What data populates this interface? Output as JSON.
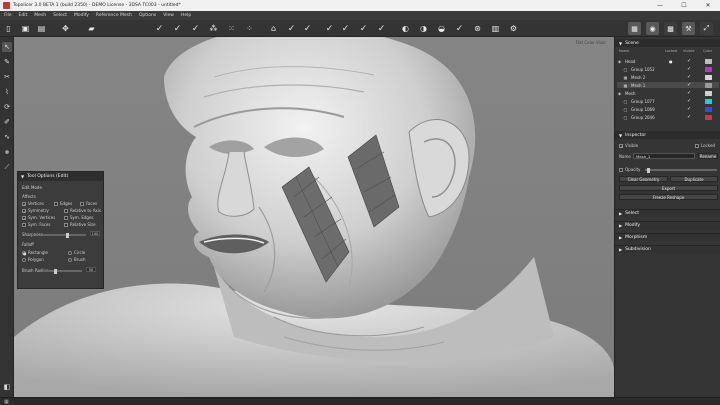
{
  "window": {
    "title": "Topolicer 3.0 BETA 1 (build 2350) - DEMO License - 3DSA TC003 - untitled*",
    "controls": [
      "—",
      "☐",
      "✕"
    ]
  },
  "menu": [
    "File",
    "Edit",
    "Mesh",
    "Select",
    "Modify",
    "Reference Mesh",
    "Options",
    "View",
    "Help"
  ],
  "viewport": {
    "label": "Flat Color Visor"
  },
  "tool_options": {
    "title": "Tool Options (Edit)",
    "mode_label": "Edit Mode",
    "group_label": "Affects",
    "rows": [
      {
        "left": "Vertices",
        "left_checked": true,
        "mid": "Edges",
        "right": "Faces"
      },
      {
        "left": "Symmetry",
        "left_checked": true,
        "mid": "Relative to Axis"
      },
      {
        "left": "Sym. Vertices",
        "left_checked": true,
        "mid": "Sym. Edges"
      },
      {
        "left": "Sym. Faces",
        "left_checked": false,
        "mid": "Relative Size"
      }
    ],
    "sharpness_label": "Sharpness",
    "sharpness_value": "100",
    "falloff_label": "Falloff",
    "falloff_rows": [
      {
        "left": "Rectangle",
        "right": "Circle"
      },
      {
        "left": "Polygon",
        "right": "Brush"
      }
    ],
    "brush_radius_label": "Brush Radius",
    "brush_radius_value": "50"
  },
  "scene": {
    "title": "Scene",
    "columns": [
      "Name",
      "Locked",
      "Visible",
      "Color"
    ],
    "rows": [
      {
        "name": "Head",
        "indent": 0,
        "icon": "mesh",
        "locked": true,
        "visible": true,
        "color": "#bdbdbd",
        "selected": false
      },
      {
        "name": "Group 1052",
        "indent": 1,
        "icon": "group",
        "locked": false,
        "visible": true,
        "color": "#b03ac0",
        "selected": false
      },
      {
        "name": "Mesh 2",
        "indent": 1,
        "icon": "grid",
        "locked": false,
        "visible": true,
        "color": "#d8d8d8",
        "selected": false
      },
      {
        "name": "Mesh 1",
        "indent": 1,
        "icon": "grid",
        "locked": false,
        "visible": true,
        "color": "#9a9a9a",
        "selected": true
      },
      {
        "name": "Mesh",
        "indent": 0,
        "icon": "mesh",
        "locked": false,
        "visible": true,
        "color": "#d0d0d0",
        "selected": false
      },
      {
        "name": "Group 1077",
        "indent": 1,
        "icon": "group",
        "locked": false,
        "visible": true,
        "color": "#30c8d0",
        "selected": false
      },
      {
        "name": "Group 1069",
        "indent": 1,
        "icon": "group",
        "locked": false,
        "visible": true,
        "color": "#3050d8",
        "selected": false
      },
      {
        "name": "Group 2046",
        "indent": 1,
        "icon": "group",
        "locked": false,
        "visible": true,
        "color": "#d83050",
        "selected": false
      }
    ]
  },
  "inspector": {
    "title": "Inspector",
    "visible_label": "Visible",
    "locked_label": "Locked",
    "name_label": "Name",
    "name_value": "Mesh_1",
    "rename_button": "Rename",
    "opacity_label": "Opacity",
    "clear_geometry_button": "Clear Geometry",
    "duplicate_button": "Duplicate",
    "export_button": "Export",
    "freeze_reshape_button": "Freeze Reshape"
  },
  "sections": [
    "Select",
    "Modify",
    "Morphism",
    "Subdivision"
  ]
}
